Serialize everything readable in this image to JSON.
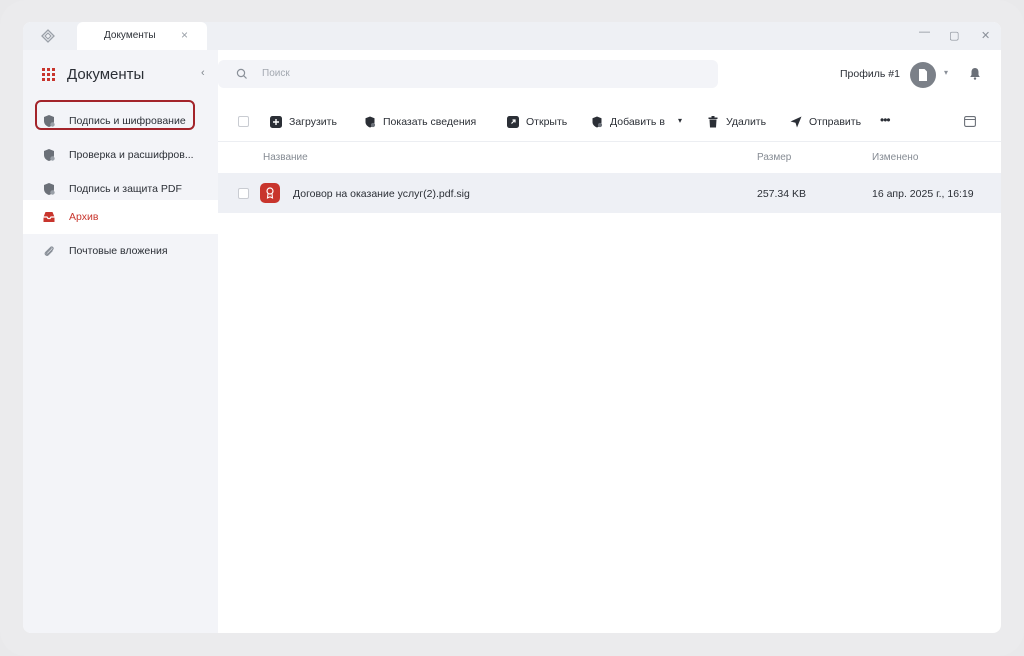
{
  "titlebar": {
    "tab_label": "Документы",
    "tab_close": "×",
    "minimize": "—",
    "maximize": "▢",
    "close": "✕"
  },
  "sidebar": {
    "title": "Документы",
    "collapse": "‹",
    "items": [
      {
        "label": "Подпись и шифрование",
        "icon": "shield-key-icon",
        "active": false,
        "highlighted": true
      },
      {
        "label": "Проверка и расшифров...",
        "icon": "shield-check-icon",
        "active": false
      },
      {
        "label": "Подпись и защита PDF",
        "icon": "shield-pdf-icon",
        "active": false
      },
      {
        "label": "Архив",
        "icon": "archive-icon",
        "active": true
      },
      {
        "label": "Почтовые вложения",
        "icon": "paperclip-icon",
        "active": false
      }
    ]
  },
  "search": {
    "placeholder": "Поиск"
  },
  "profile": {
    "label": "Профиль #1"
  },
  "toolbar": {
    "upload": "Загрузить",
    "details": "Показать сведения",
    "open": "Открыть",
    "add_to": "Добавить в",
    "delete": "Удалить",
    "send": "Отправить",
    "more": "•••"
  },
  "table": {
    "columns": {
      "name": "Название",
      "size": "Размер",
      "modified": "Изменено"
    },
    "rows": [
      {
        "name": "Договор на оказание услуг(2).pdf.sig",
        "size": "257.34 KB",
        "modified": "16 апр. 2025 г., 16:19"
      }
    ]
  },
  "colors": {
    "accent": "#c8352d",
    "highlight_border": "#a3232a",
    "sidebar_bg": "#f3f4f8",
    "row_selected": "#eef0f5"
  }
}
